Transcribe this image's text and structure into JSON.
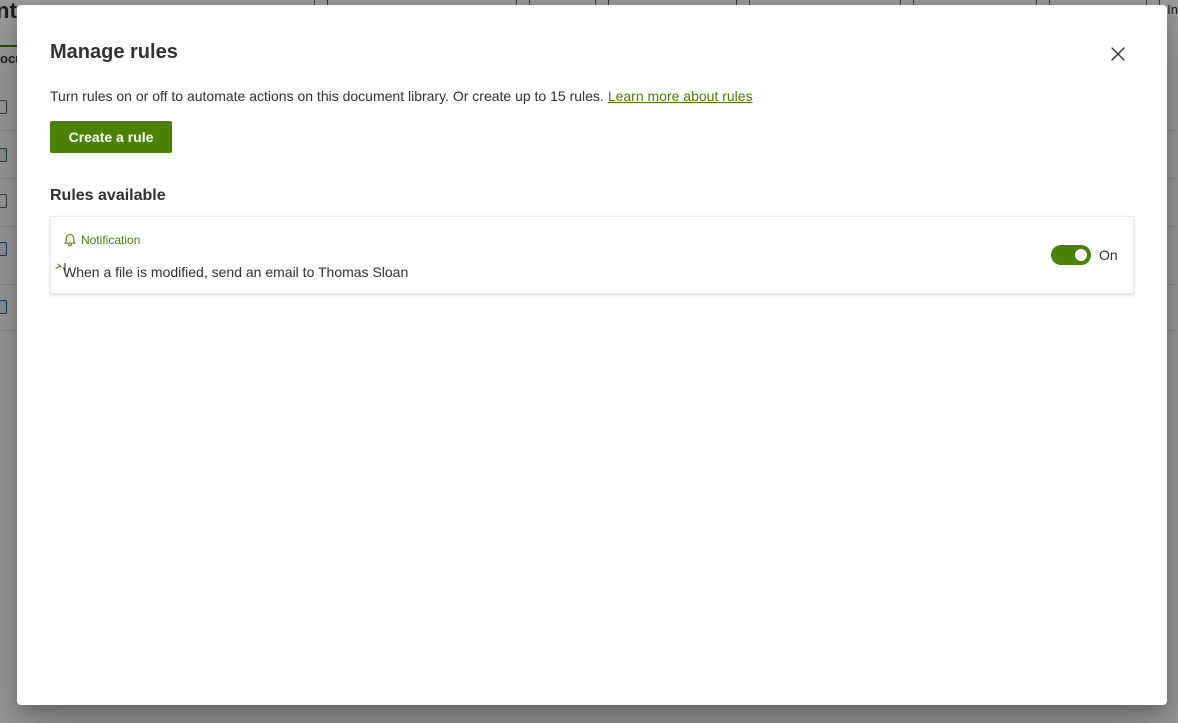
{
  "background": {
    "page_title_fragment": "nt",
    "tab_fragment": "ocu",
    "right_fragment": "In"
  },
  "dialog": {
    "title": "Manage rules",
    "close_icon": "close-icon",
    "description": "Turn rules on or off to automate actions on this document library. Or create up to 15 rules.",
    "learn_more_link": "Learn more about rules",
    "create_button": "Create a rule",
    "section_heading": "Rules available",
    "rules": [
      {
        "type_icon": "bell-icon",
        "type_label": "Notification",
        "description": "When a file is modified, send an email to Thomas Sloan",
        "enabled": true,
        "toggle_label": "On"
      }
    ]
  },
  "colors": {
    "accent": "#498205",
    "text": "#323130",
    "overlay": "rgba(0,0,0,0.40)"
  }
}
